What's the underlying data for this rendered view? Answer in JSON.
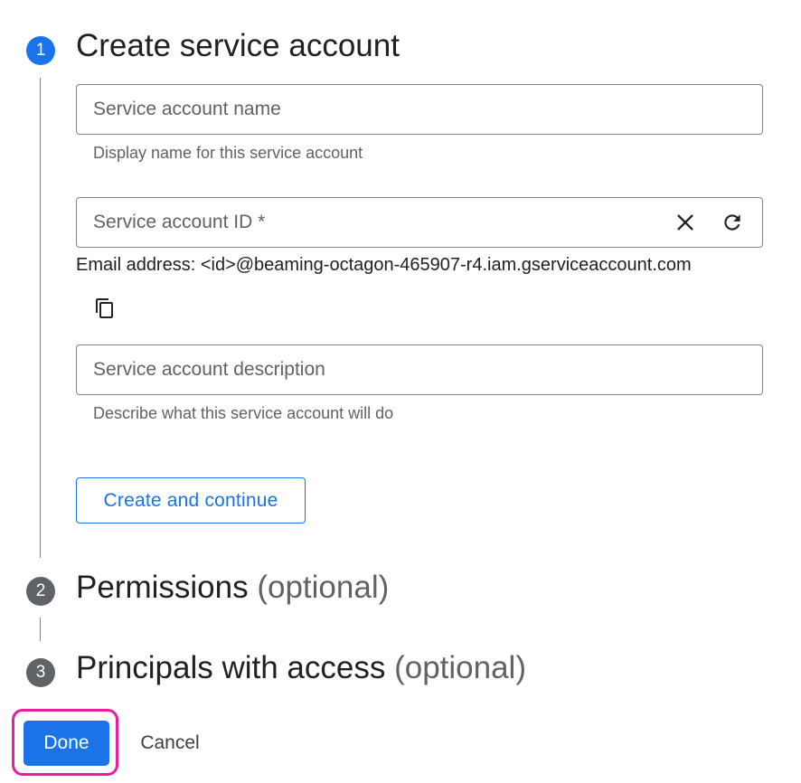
{
  "steps": [
    {
      "number": "1",
      "title": "Create service account",
      "optional": ""
    },
    {
      "number": "2",
      "title": "Permissions",
      "optional": "(optional)"
    },
    {
      "number": "3",
      "title": "Principals with access",
      "optional": "(optional)"
    }
  ],
  "form": {
    "name_field": {
      "placeholder": "Service account name",
      "value": "",
      "hint": "Display name for this service account"
    },
    "id_field": {
      "placeholder": "Service account ID *",
      "value": ""
    },
    "email_address": "Email address: <id>@beaming-octagon-465907-r4.iam.gserviceaccount.com",
    "description_field": {
      "placeholder": "Service account description",
      "value": "",
      "hint": "Describe what this service account will do"
    },
    "create_button_label": "Create and continue"
  },
  "icons": {
    "clear": "close-icon",
    "refresh": "refresh-icon",
    "copy": "copy-icon"
  },
  "footer": {
    "done_label": "Done",
    "cancel_label": "Cancel"
  },
  "colors": {
    "primary": "#1a73e8",
    "step_inactive": "#5f6368",
    "highlight": "#e91e9e"
  }
}
